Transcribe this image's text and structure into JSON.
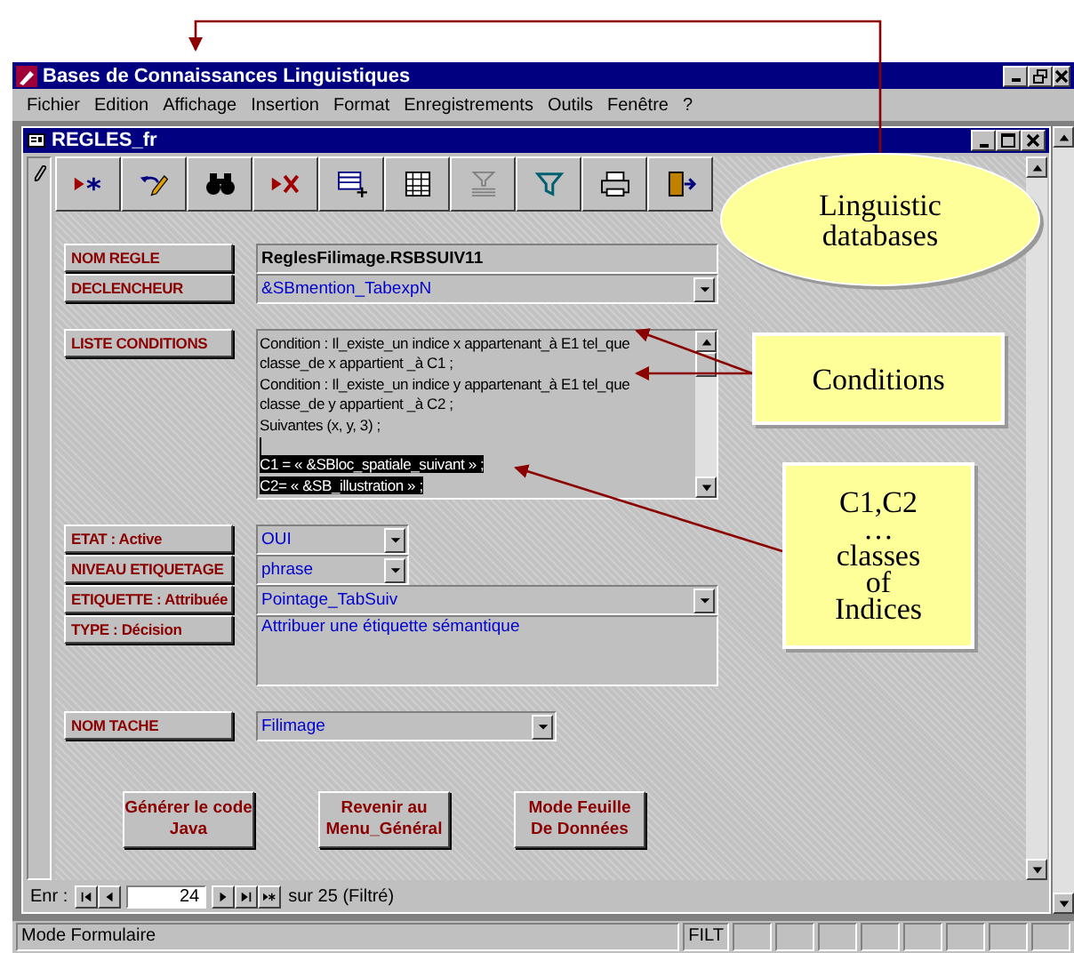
{
  "window": {
    "title": "Bases de Connaissances Linguistiques"
  },
  "menu": [
    "Fichier",
    "Edition",
    "Affichage",
    "Insertion",
    "Format",
    "Enregistrements",
    "Outils",
    "Fenêtre",
    "?"
  ],
  "form_window": {
    "title": "REGLES_fr"
  },
  "sections": [
    {
      "fields": [
        {
          "label": "NOM REGLE",
          "kind": "text",
          "value": "ReglesFilimage.RSBSUIV11"
        },
        {
          "label": "DECLENCHEUR",
          "kind": "combo",
          "value": "&SBmention_TabexpN"
        }
      ]
    },
    {
      "fields": [
        {
          "label": "LISTE CONDITIONS",
          "kind": "memo",
          "lines": [
            {
              "text": "Condition : Il_existe_un indice x appartenant_à E1 tel_que",
              "selected": false
            },
            {
              "text": "classe_de x appartient _à C1 ;",
              "selected": false
            },
            {
              "text": "Condition : Il_existe_un indice y appartenant_à E1 tel_que",
              "selected": false
            },
            {
              "text": "classe_de y appartient _à C2 ;",
              "selected": false
            },
            {
              "text": "Suivantes (x, y, 3) ;",
              "selected": false
            },
            {
              "text": "C1 = « &SBloc_spatiale_suivant » ;",
              "selected": true
            },
            {
              "text": "C2= « &SB_illustration » ;",
              "selected": true
            }
          ]
        }
      ]
    },
    {
      "fields": [
        {
          "label": "ETAT : Active",
          "kind": "short-combo",
          "value": "OUI"
        },
        {
          "label": "NIVEAU ETIQUETAGE",
          "kind": "short-combo",
          "value": "phrase"
        },
        {
          "label": "ETIQUETTE : Attribuée",
          "kind": "combo",
          "value": "Pointage_TabSuiv"
        },
        {
          "label": "TYPE : Décision",
          "kind": "textarea",
          "value": "Attribuer une étiquette sémantique"
        }
      ]
    },
    {
      "fields": [
        {
          "label": "NOM TACHE",
          "kind": "mid-combo",
          "value": "Filimage"
        }
      ]
    }
  ],
  "buttons": [
    "Générer le code Java",
    "Revenir au Menu_Général",
    "Mode Feuille De Données"
  ],
  "navigator": {
    "label": "Enr :",
    "record": "24",
    "total": "sur  25 (Filtré)"
  },
  "status_bar": {
    "mode": "Mode Formulaire",
    "indicator": "FILT"
  },
  "annotations": [
    {
      "kind": "ellipse",
      "text": "Linguistic\ndatabases"
    },
    {
      "kind": "box",
      "text": "Conditions"
    },
    {
      "kind": "box",
      "text": "C1,C2\n…\nclasses\nof\nIndices"
    }
  ]
}
